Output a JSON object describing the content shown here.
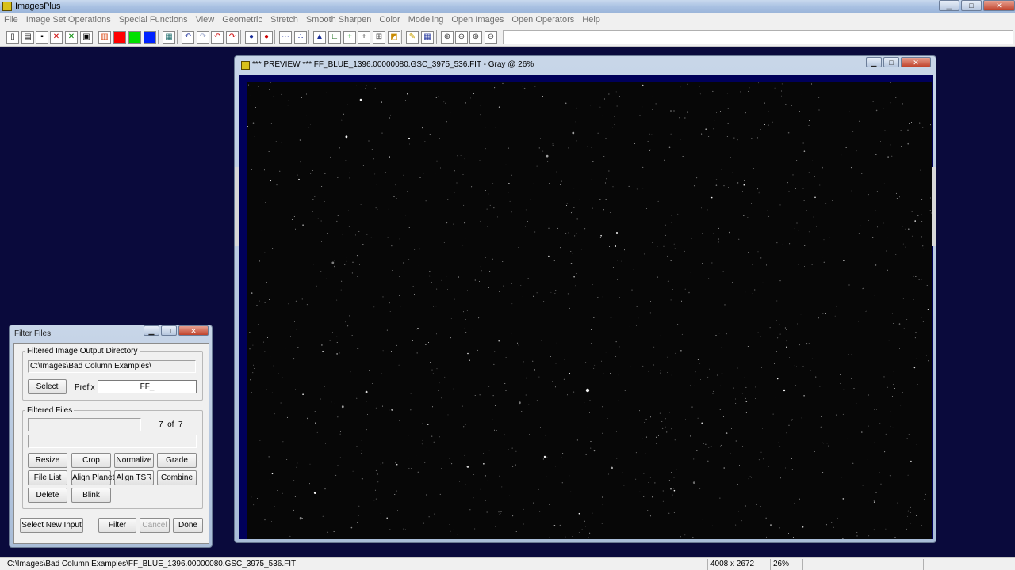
{
  "app": {
    "title": "ImagesPlus"
  },
  "menu": [
    "File",
    "Image Set Operations",
    "Special Functions",
    "View",
    "Geometric",
    "Stretch",
    "Smooth Sharpen",
    "Color",
    "Modeling",
    "Open Images",
    "Open Operators",
    "Help"
  ],
  "toolbar": {
    "tools": [
      {
        "name": "new-file-icon",
        "glyph": "▯"
      },
      {
        "name": "open-folder-icon",
        "glyph": "▤"
      },
      {
        "name": "save-icon",
        "glyph": "▪"
      },
      {
        "name": "close-image-icon",
        "glyph": "✕",
        "color": "#cc0000"
      },
      {
        "name": "close-all-icon",
        "glyph": "✕",
        "color": "#008800"
      },
      {
        "name": "copy-window-icon",
        "glyph": "▣"
      },
      {
        "name": "rgb-channels-icon",
        "glyph": "▥",
        "color": "#d83a00"
      },
      {
        "name": "red-channel-icon",
        "glyph": "",
        "bg": "#ff0000"
      },
      {
        "name": "green-channel-icon",
        "glyph": "",
        "bg": "#00e000"
      },
      {
        "name": "blue-channel-icon",
        "glyph": "",
        "bg": "#0022ff"
      },
      {
        "name": "grid-pattern-icon",
        "glyph": "▦",
        "color": "#1a6b6b"
      },
      {
        "name": "undo-icon",
        "glyph": "↶",
        "color": "#1a2e99"
      },
      {
        "name": "redo-icon",
        "glyph": "↷",
        "color": "#9aa6cc"
      },
      {
        "name": "undo-red-icon",
        "glyph": "↶",
        "color": "#cc0000"
      },
      {
        "name": "redo-red-icon",
        "glyph": "↷",
        "color": "#cc0000"
      },
      {
        "name": "blue-dot-icon",
        "glyph": "●",
        "color": "#1a2e99"
      },
      {
        "name": "red-dot-icon",
        "glyph": "●",
        "color": "#cc0000"
      },
      {
        "name": "dotted-line-icon",
        "glyph": "⋯",
        "color": "#1a2e99"
      },
      {
        "name": "point-plot-icon",
        "glyph": "∴",
        "color": "#1a2e99"
      },
      {
        "name": "histogram-icon",
        "glyph": "▲",
        "color": "#1a2e99"
      },
      {
        "name": "axis-icon",
        "glyph": "∟",
        "color": "#1a6b1a"
      },
      {
        "name": "crosshair-green-icon",
        "glyph": "+",
        "color": "#009900"
      },
      {
        "name": "crosshair-icon",
        "glyph": "+",
        "color": "#333333"
      },
      {
        "name": "select-region-icon",
        "glyph": "⊞",
        "color": "#333333"
      },
      {
        "name": "image-info-icon",
        "glyph": "◩",
        "color": "#c88a00"
      },
      {
        "name": "pencil-icon",
        "glyph": "✎",
        "color": "#c8a000"
      },
      {
        "name": "pixel-grid-icon",
        "glyph": "▦",
        "color": "#1a2e99"
      },
      {
        "name": "zoom-in-icon",
        "glyph": "⊕",
        "color": "#333333"
      },
      {
        "name": "zoom-out-icon",
        "glyph": "⊖",
        "color": "#333333"
      },
      {
        "name": "zoom-fit-icon",
        "glyph": "⊕",
        "color": "#333333"
      },
      {
        "name": "zoom-actual-icon",
        "glyph": "⊖",
        "color": "#333333"
      }
    ]
  },
  "preview": {
    "title": "*** PREVIEW *** FF_BLUE_1396.00000080.GSC_3975_536.FIT - Gray @ 26%"
  },
  "filter_files": {
    "title": "Filter Files",
    "output_group_label": "Filtered Image Output Directory",
    "output_directory": "C:\\Images\\Bad Column Examples\\",
    "select_label": "Select",
    "prefix_label": "Prefix",
    "prefix_value": "FF_",
    "files_group_label": "Filtered Files",
    "current_file": "",
    "progress_current": "7",
    "progress_of": "of",
    "progress_total": "7",
    "file_status": "",
    "buttons": {
      "resize": "Resize",
      "crop": "Crop",
      "normalize": "Normalize",
      "grade": "Grade",
      "file_list": "File List",
      "align_planet": "Align Planet",
      "align_tsr": "Align TSR",
      "combine": "Combine",
      "delete": "Delete",
      "blink": "Blink",
      "select_new_input": "Select New Input",
      "filter": "Filter",
      "cancel": "Cancel",
      "done": "Done"
    }
  },
  "status": {
    "path": "C:\\Images\\Bad Column Examples\\FF_BLUE_1396.00000080.GSC_3975_536.FIT",
    "dimensions": "4008 x 2672",
    "zoom": "26%"
  }
}
